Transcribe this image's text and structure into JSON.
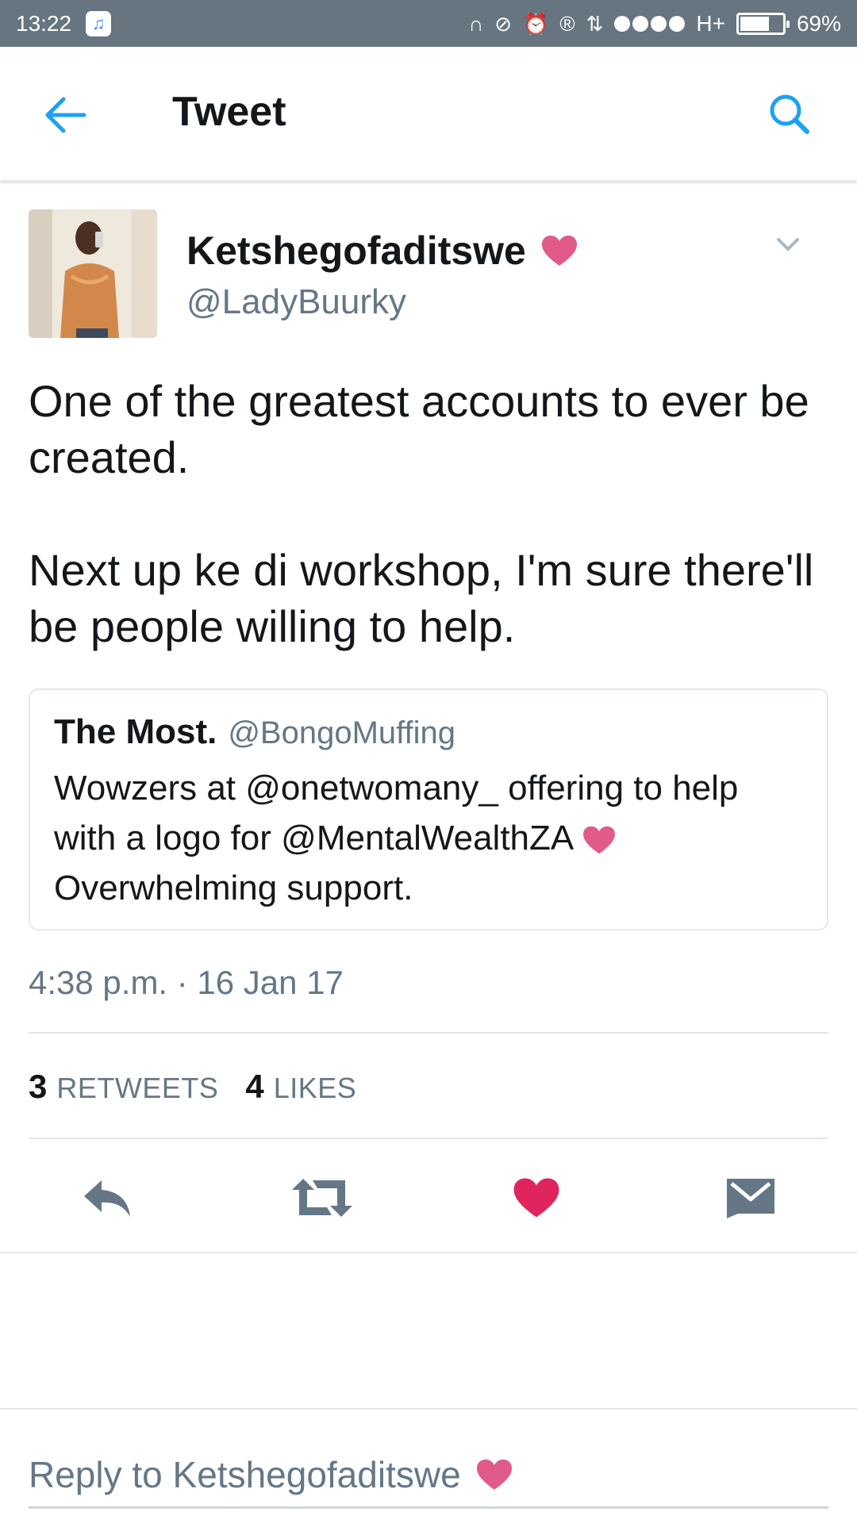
{
  "status_bar": {
    "time": "13:22",
    "network": "H+",
    "battery": "69%",
    "battery_level": 0.69
  },
  "header": {
    "title": "Tweet",
    "accent_color": "#1da1f2"
  },
  "tweet": {
    "display_name": "Ketshegofaditswe",
    "handle": "@LadyBuurky",
    "text_paragraphs": [
      "One of the greatest accounts to ever be created.",
      "Next up ke di workshop, I'm sure there'll be people willing to help."
    ],
    "timestamp": "4:38 p.m. · 16 Jan 17",
    "retweets_count": "3",
    "retweets_label": "RETWEETS",
    "likes_count": "4",
    "likes_label": "LIKES",
    "like_color": "#e0245e",
    "heart_emoji_color": "#e05a8a"
  },
  "quote": {
    "name": "The Most.",
    "handle": "@BongoMuffing",
    "text_before_heart": "Wowzers at @onetwomany_ offering to help with a logo for @MentalWealthZA",
    "text_after_heart": "Overwhelming support."
  },
  "reply": {
    "placeholder": "Reply to Ketshegofaditswe"
  },
  "icons": [
    "back-arrow-icon",
    "search-icon",
    "chevron-down-icon",
    "reply-icon",
    "retweet-icon",
    "heart-icon",
    "direct-message-icon"
  ]
}
